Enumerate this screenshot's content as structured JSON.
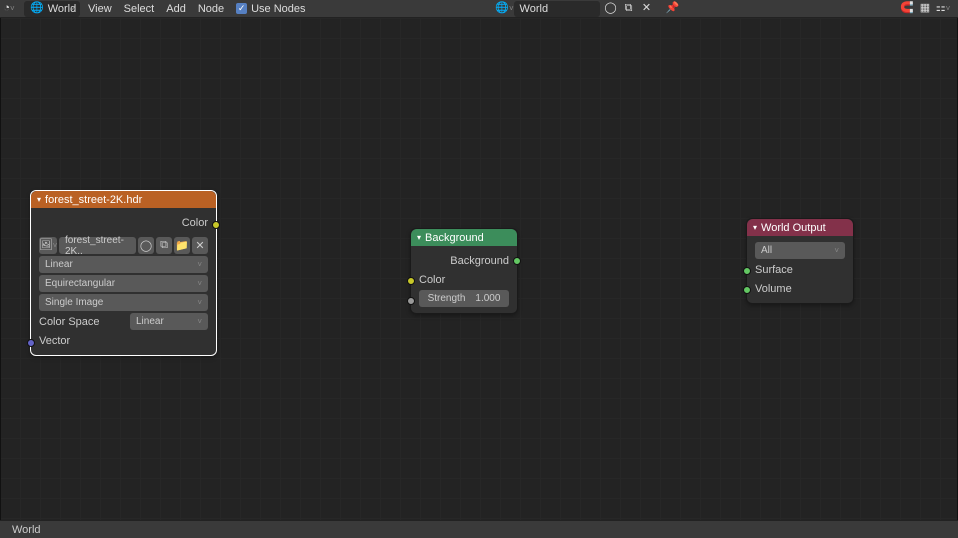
{
  "header": {
    "mode_label": "World",
    "menus": [
      "View",
      "Select",
      "Add",
      "Node"
    ],
    "use_nodes_label": "Use Nodes",
    "datablock_label": "World"
  },
  "statusbar": {
    "label": "World"
  },
  "nodes": {
    "envtex": {
      "title": "forest_street-2K.hdr",
      "image_name": "forest_street-2K..",
      "interpolation": "Linear",
      "projection": "Equirectangular",
      "source": "Single Image",
      "colorspace_label": "Color Space",
      "colorspace_value": "Linear",
      "output_color": "Color",
      "input_vector": "Vector"
    },
    "background": {
      "title": "Background",
      "output": "Background",
      "input_color": "Color",
      "input_strength_label": "Strength",
      "input_strength_value": "1.000"
    },
    "worldout": {
      "title": "World Output",
      "target": "All",
      "input_surface": "Surface",
      "input_volume": "Volume"
    }
  }
}
